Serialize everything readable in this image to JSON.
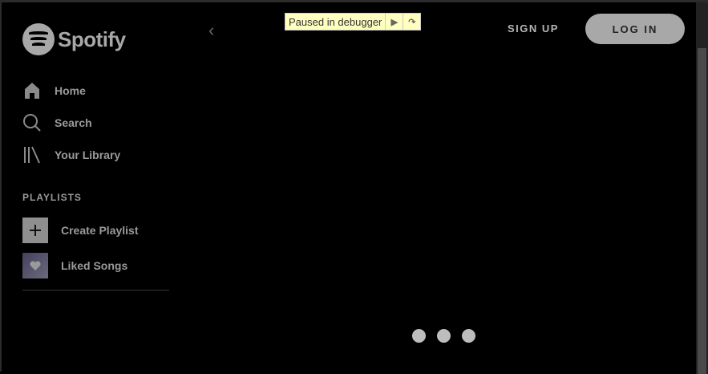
{
  "brand": "Spotify",
  "nav": [
    {
      "label": "Home",
      "icon": "home-icon"
    },
    {
      "label": "Search",
      "icon": "search-icon"
    },
    {
      "label": "Your Library",
      "icon": "library-icon"
    }
  ],
  "playlists": {
    "heading": "PLAYLISTS",
    "items": [
      {
        "label": "Create Playlist",
        "icon": "plus-icon"
      },
      {
        "label": "Liked Songs",
        "icon": "heart-icon"
      }
    ]
  },
  "debugger": {
    "label": "Paused in debugger"
  },
  "header": {
    "signup": "SIGN UP",
    "login": "LOG IN"
  }
}
